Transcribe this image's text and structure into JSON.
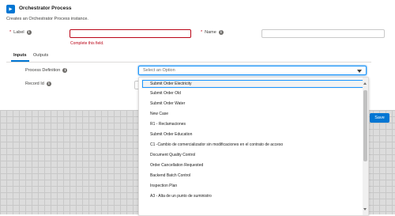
{
  "header": {
    "title": "Orchestrator Process",
    "subtitle": "Creates an Orchestrator Process instance."
  },
  "fields": {
    "label": {
      "label": "Label",
      "required_mark": "*",
      "value": "",
      "error": "Complete this field."
    },
    "name": {
      "label": "Name",
      "required_mark": "*",
      "value": ""
    }
  },
  "tabs": [
    {
      "label": "Inputs",
      "active": true
    },
    {
      "label": "Outputs",
      "active": false
    }
  ],
  "inputs": {
    "process_definition": {
      "label": "Process Definition",
      "placeholder": "Select an Option"
    },
    "record_id": {
      "label": "Record Id"
    }
  },
  "dropdown_options": [
    "Submit Order Electricity",
    "Submit Order Old",
    "Submit Order Water",
    "New Case",
    "R1 - Reclamaciones",
    "Submit Order Education",
    "C1 -Cambio de comercializador sin modificaciones en el contrato de acceso",
    "Document Quality Control",
    "Order Cancellation Requested",
    "Backend Batch Control",
    "Inspection Plan",
    "A3 - Alta de un punto de suministro"
  ],
  "footer": {
    "save_label": "Save"
  },
  "colors": {
    "brand": "#0176d3",
    "error": "#ba0517"
  },
  "icons": {
    "header": "orchestrator-icon",
    "info": "info-icon"
  }
}
